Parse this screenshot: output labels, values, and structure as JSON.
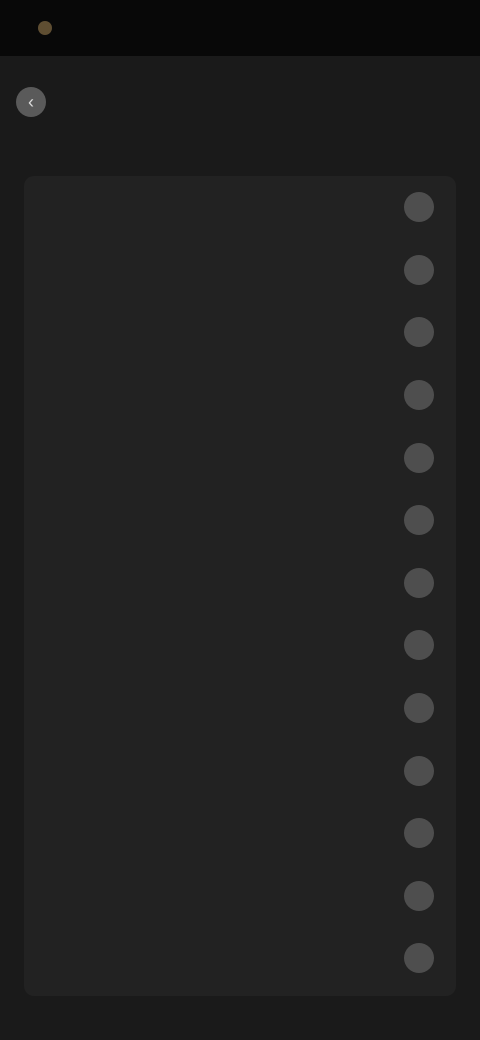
{
  "status_bar": {
    "time": "",
    "right": ""
  },
  "nav": {
    "back_label": "",
    "action_label": ""
  },
  "section": {
    "title": ""
  },
  "list": {
    "items": [
      {
        "label": "",
        "badge": ""
      },
      {
        "label": "",
        "badge": ""
      },
      {
        "label": "",
        "badge": ""
      },
      {
        "label": "",
        "badge": ""
      },
      {
        "label": "",
        "badge": ""
      },
      {
        "label": "",
        "badge": ""
      },
      {
        "label": "",
        "badge": ""
      },
      {
        "label": "",
        "badge": ""
      },
      {
        "label": "",
        "badge": ""
      },
      {
        "label": "",
        "badge": ""
      },
      {
        "label": "",
        "badge": ""
      },
      {
        "label": "",
        "badge": ""
      },
      {
        "label": "",
        "badge": ""
      }
    ]
  },
  "colors": {
    "background": "#0c0c0c",
    "surface": "#1a1a1a",
    "panel": "#222222",
    "badge": "#4e4e4e",
    "accent": "#6e5a3a"
  },
  "icons": {
    "status_left": "app-indicator-icon",
    "back": "chevron-left-icon",
    "row_badge": "circle-badge-icon"
  }
}
